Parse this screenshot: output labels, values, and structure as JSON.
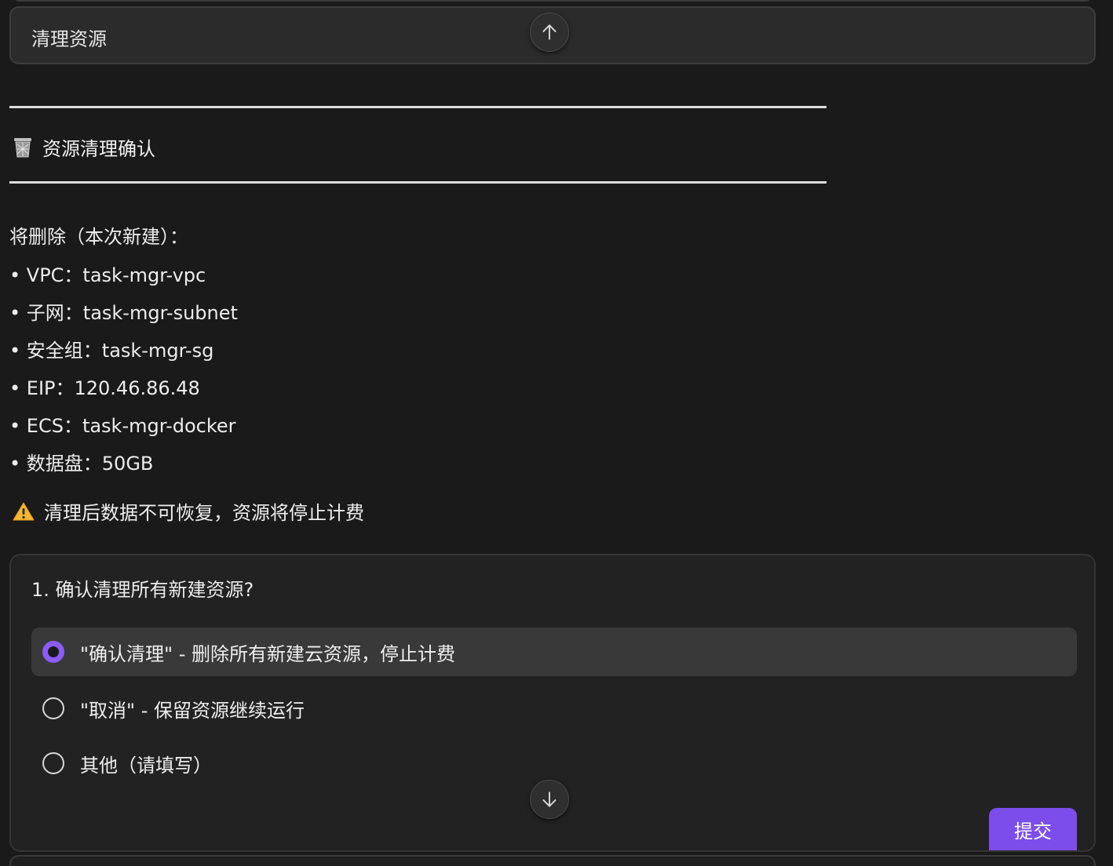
{
  "header": {
    "title": "清理资源"
  },
  "section": {
    "title": "资源清理确认",
    "icon": "wastebasket-icon"
  },
  "resources": {
    "intro": "将删除（本次新建）：",
    "items": [
      "• VPC：task-mgr-vpc",
      "• 子网：task-mgr-subnet",
      "• 安全组：task-mgr-sg",
      "• EIP：120.46.86.48",
      "• ECS：task-mgr-docker",
      "• 数据盘：50GB"
    ]
  },
  "warning": {
    "icon": "warning-icon",
    "text": "清理后数据不可恢复，资源将停止计费"
  },
  "question": {
    "text": "1. 确认清理所有新建资源?",
    "options": [
      {
        "label": "\"确认清理\" - 删除所有新建云资源，停止计费",
        "selected": true
      },
      {
        "label": "\"取消\" - 保留资源继续运行",
        "selected": false
      },
      {
        "label": "其他（请填写）",
        "selected": false
      }
    ],
    "submit_label": "提交"
  },
  "colors": {
    "accent": "#7c4dea",
    "radio_selected": "#8b5cf6",
    "background": "#1a1a1a"
  }
}
